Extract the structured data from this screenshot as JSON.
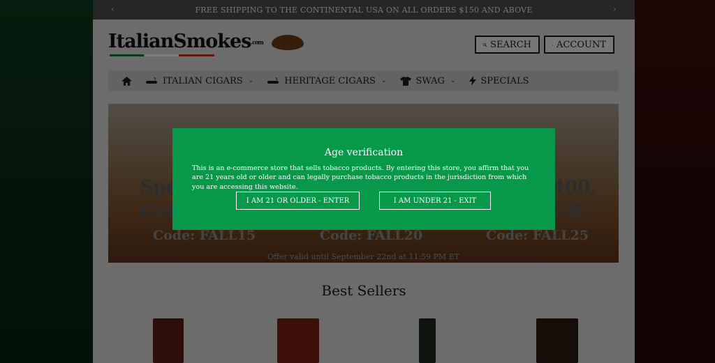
{
  "topbar": {
    "promo_text": "FREE SHIPPING TO THE CONTINENTAL USA ON ALL ORDERS $150 AND ABOVE",
    "prev_arrow": "‹",
    "next_arrow": "›"
  },
  "header": {
    "logo_text": "ItalianSmokes",
    "logo_suffix": ".com",
    "search_label": "SEARCH",
    "account_label": "ACCOUNT"
  },
  "nav": {
    "items": [
      {
        "label": "ITALIAN CIGARS"
      },
      {
        "label": "HERITAGE CIGARS"
      },
      {
        "label": "SWAG"
      },
      {
        "label": "SPECIALS"
      }
    ]
  },
  "hero": {
    "left_big_1": "Spe",
    "left_big_2": "Get",
    "right_big_1": "400,",
    "right_big_2": "Off!",
    "codes": [
      "Code: FALL15",
      "Code: FALL20",
      "Code: FALL25"
    ],
    "valid_text": "Offer valid until September 22nd at 11:59 PM ET"
  },
  "sections": {
    "best_sellers_title": "Best Sellers"
  },
  "modal": {
    "title": "Age verification",
    "body": "This is an e-commerce store that sells tobacco products. By entering this store, you affirm that you are 21 years old or older and can legally purchase tobacco products in the jurisdiction from which you are accessing this website.",
    "enter_label": "I AM 21 OR OLDER - ENTER",
    "exit_label": "I AM UNDER 21 - EXIT"
  },
  "colors": {
    "modal_bg": "#079949",
    "flag_green": "#0a7a30",
    "flag_red": "#c62828"
  }
}
